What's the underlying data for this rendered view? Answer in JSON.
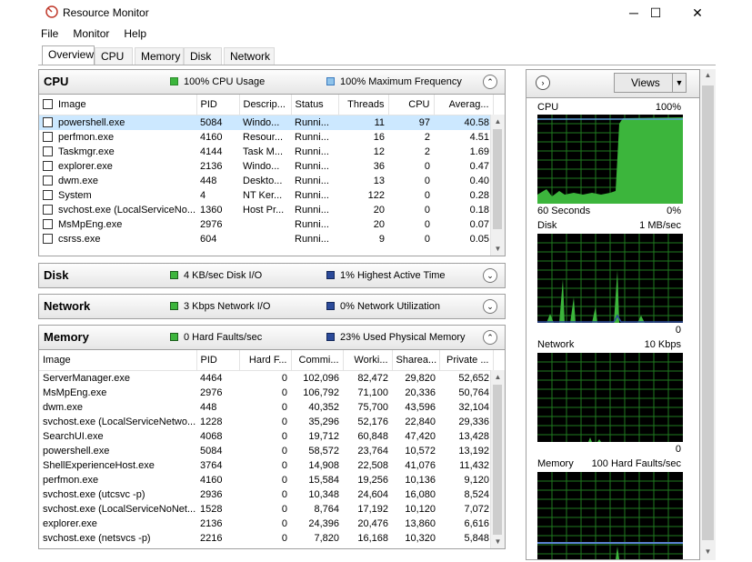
{
  "window": {
    "title": "Resource Monitor",
    "minimize": "─",
    "maximize": "☐",
    "close": "✕"
  },
  "menu": [
    "File",
    "Monitor",
    "Help"
  ],
  "tabs": [
    "Overview",
    "CPU",
    "Memory",
    "Disk",
    "Network"
  ],
  "cpu": {
    "title": "CPU",
    "usage": "100% CPU Usage",
    "frequency": "100% Maximum Frequency",
    "columns": [
      "Image",
      "PID",
      "Descrip...",
      "Status",
      "Threads",
      "CPU",
      "Averag..."
    ],
    "rows": [
      [
        "powershell.exe",
        "5084",
        "Windo...",
        "Runni...",
        "11",
        "97",
        "40.58"
      ],
      [
        "perfmon.exe",
        "4160",
        "Resour...",
        "Runni...",
        "16",
        "2",
        "4.51"
      ],
      [
        "Taskmgr.exe",
        "4144",
        "Task M...",
        "Runni...",
        "12",
        "2",
        "1.69"
      ],
      [
        "explorer.exe",
        "2136",
        "Windo...",
        "Runni...",
        "36",
        "0",
        "0.47"
      ],
      [
        "dwm.exe",
        "448",
        "Deskto...",
        "Runni...",
        "13",
        "0",
        "0.40"
      ],
      [
        "System",
        "4",
        "NT Ker...",
        "Runni...",
        "122",
        "0",
        "0.28"
      ],
      [
        "svchost.exe (LocalServiceNo...",
        "1360",
        "Host Pr...",
        "Runni...",
        "20",
        "0",
        "0.18"
      ],
      [
        "MsMpEng.exe",
        "2976",
        "",
        "Runni...",
        "20",
        "0",
        "0.07"
      ],
      [
        "csrss.exe",
        "604",
        "",
        "Runni...",
        "9",
        "0",
        "0.05"
      ]
    ]
  },
  "disk": {
    "title": "Disk",
    "io": "4 KB/sec Disk I/O",
    "active": "1% Highest Active Time"
  },
  "network": {
    "title": "Network",
    "io": "3 Kbps Network I/O",
    "util": "0% Network Utilization"
  },
  "memory": {
    "title": "Memory",
    "faults": "0 Hard Faults/sec",
    "used": "23% Used Physical Memory",
    "columns": [
      "Image",
      "PID",
      "Hard F...",
      "Commi...",
      "Worki...",
      "Sharea...",
      "Private ..."
    ],
    "rows": [
      [
        "ServerManager.exe",
        "4464",
        "0",
        "102,096",
        "82,472",
        "29,820",
        "52,652"
      ],
      [
        "MsMpEng.exe",
        "2976",
        "0",
        "106,792",
        "71,100",
        "20,336",
        "50,764"
      ],
      [
        "dwm.exe",
        "448",
        "0",
        "40,352",
        "75,700",
        "43,596",
        "32,104"
      ],
      [
        "svchost.exe (LocalServiceNetwo...",
        "1228",
        "0",
        "35,296",
        "52,176",
        "22,840",
        "29,336"
      ],
      [
        "SearchUI.exe",
        "4068",
        "0",
        "19,712",
        "60,848",
        "47,420",
        "13,428"
      ],
      [
        "powershell.exe",
        "5084",
        "0",
        "58,572",
        "23,764",
        "10,572",
        "13,192"
      ],
      [
        "ShellExperienceHost.exe",
        "3764",
        "0",
        "14,908",
        "22,508",
        "41,076",
        "11,432"
      ],
      [
        "perfmon.exe",
        "4160",
        "0",
        "15,584",
        "19,256",
        "10,136",
        "9,120"
      ],
      [
        "svchost.exe (utcsvc -p)",
        "2936",
        "0",
        "10,348",
        "24,604",
        "16,080",
        "8,524"
      ],
      [
        "svchost.exe (LocalServiceNoNet...",
        "1528",
        "0",
        "8,764",
        "17,192",
        "10,120",
        "7,072"
      ],
      [
        "explorer.exe",
        "2136",
        "0",
        "24,396",
        "20,476",
        "13,860",
        "6,616"
      ],
      [
        "svchost.exe (netsvcs -p)",
        "2216",
        "0",
        "7,820",
        "16,168",
        "10,320",
        "5,848"
      ]
    ]
  },
  "graphs": {
    "views_label": "Views",
    "cpu": {
      "name": "CPU",
      "max": "100%",
      "time": "60 Seconds",
      "min": "0%"
    },
    "disk": {
      "name": "Disk",
      "max": "1 MB/sec",
      "min": "0"
    },
    "network": {
      "name": "Network",
      "max": "10 Kbps",
      "min": "0"
    },
    "memory": {
      "name": "Memory",
      "max": "100 Hard Faults/sec"
    }
  },
  "colors": {
    "green": "#3cb53c",
    "blue": "#5b9bd5",
    "navy": "#2b4a9a",
    "selection": "#cce8ff"
  }
}
